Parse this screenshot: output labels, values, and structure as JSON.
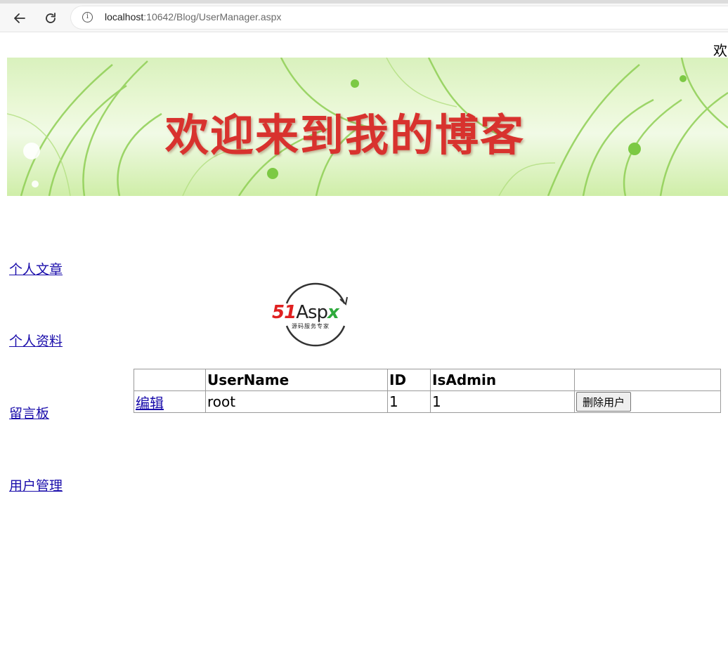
{
  "browser": {
    "url_host": "localhost",
    "url_path": ":10642/Blog/UserManager.aspx"
  },
  "header": {
    "welcome_text": "欢",
    "banner_title": "欢迎来到我的博客"
  },
  "sidebar": {
    "items": [
      {
        "label": "个人文章"
      },
      {
        "label": "个人资料"
      },
      {
        "label": "留言板"
      },
      {
        "label": "用户管理"
      }
    ]
  },
  "logo": {
    "brand_red": "51",
    "brand_black": "Asp",
    "brand_green": "x",
    "tagline": "源码服务专家",
    "colors": {
      "red": "#e02020",
      "green": "#2eaa3c",
      "black": "#222222"
    }
  },
  "table": {
    "headers": [
      "",
      "UserName",
      "ID",
      "IsAdmin",
      ""
    ],
    "rows": [
      {
        "edit": "编辑",
        "username": "root",
        "id": "1",
        "isadmin": "1",
        "delete": "删除用户"
      }
    ]
  },
  "colors": {
    "link": "#1a0dab",
    "banner_text": "#d8322e"
  }
}
